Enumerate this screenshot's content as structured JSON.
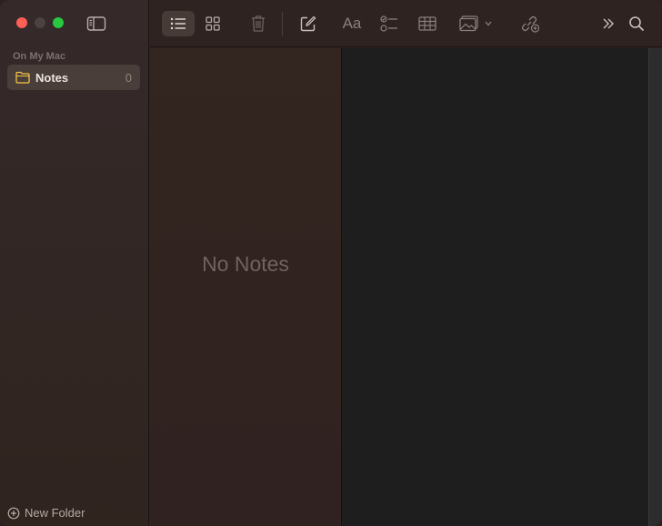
{
  "window": {
    "traffic_lights": {
      "close": "#fe5f57",
      "minimize": "#4a4241",
      "zoom": "#28c840"
    }
  },
  "sidebar": {
    "section_label": "On My Mac",
    "folders": [
      {
        "name": "Notes",
        "count": "0",
        "selected": true,
        "icon": "folder-icon"
      }
    ],
    "new_folder_label": "New Folder"
  },
  "toolbar": {
    "items": [
      {
        "name": "list-view",
        "icon": "list-icon",
        "active": true
      },
      {
        "name": "gallery-view",
        "icon": "grid-icon",
        "active": false
      },
      {
        "name": "delete",
        "icon": "trash-icon",
        "active": false
      },
      {
        "name": "new-note",
        "icon": "compose-icon",
        "active": false
      },
      {
        "name": "format",
        "icon": "format-text-icon",
        "label": "Aa"
      },
      {
        "name": "checklist",
        "icon": "checklist-icon"
      },
      {
        "name": "table",
        "icon": "table-icon"
      },
      {
        "name": "media",
        "icon": "photo-icon"
      },
      {
        "name": "collaborate",
        "icon": "link-add-icon"
      },
      {
        "name": "more",
        "icon": "chevron-double-right-icon"
      },
      {
        "name": "search",
        "icon": "search-icon"
      }
    ]
  },
  "note_list": {
    "empty_message": "No Notes"
  },
  "colors": {
    "accent_folder": "#f5c443",
    "sidebar_bg": "#33271f",
    "editor_bg": "#1e1e1e"
  }
}
